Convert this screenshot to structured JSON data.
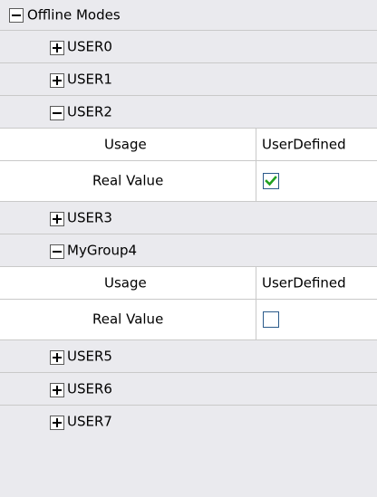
{
  "tree": {
    "root": {
      "label": "Offline Modes",
      "expanded": true
    },
    "user0": {
      "label": "USER0",
      "expanded": false
    },
    "user1": {
      "label": "USER1",
      "expanded": false
    },
    "user2": {
      "label": "USER2",
      "expanded": true,
      "usage": {
        "name": "Usage",
        "value": "UserDefined"
      },
      "real_value": {
        "name": "Real Value",
        "checked": true
      }
    },
    "user3": {
      "label": "USER3",
      "expanded": false
    },
    "mygroup4": {
      "label": "MyGroup4",
      "expanded": true,
      "usage": {
        "name": "Usage",
        "value": "UserDefined"
      },
      "real_value": {
        "name": "Real Value",
        "checked": false
      }
    },
    "user5": {
      "label": "USER5",
      "expanded": false
    },
    "user6": {
      "label": "USER6",
      "expanded": false
    },
    "user7": {
      "label": "USER7",
      "expanded": false
    }
  },
  "colors": {
    "group_row_bg": "#eaeaee",
    "grid_line": "#c9c9c9",
    "checkbox_border": "#2a5a8a",
    "checkmark": "#21a121"
  }
}
